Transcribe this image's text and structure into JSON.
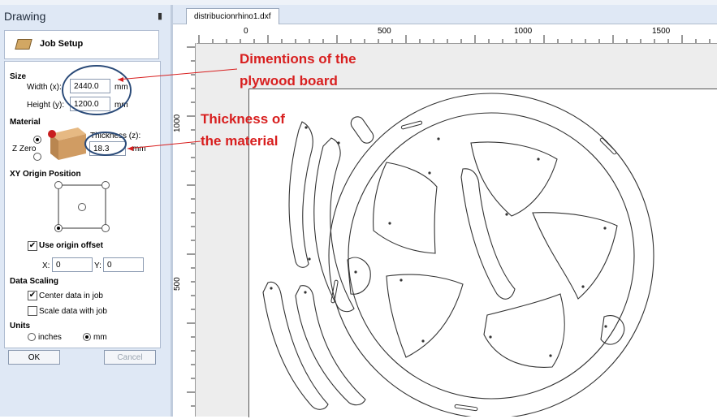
{
  "panel": {
    "title": "Drawing",
    "pin_glyph": "Ͱ",
    "job_setup_label": "Job Setup"
  },
  "size": {
    "header": "Size",
    "width_label": "Width (x):",
    "width_value": "2440.0",
    "width_unit": "mm",
    "height_label": "Height (y):",
    "height_value": "1200.0",
    "height_unit": "mm"
  },
  "material": {
    "header": "Material",
    "z_zero_label": "Z Zero",
    "thickness_label": "Thickness (z):",
    "thickness_value": "18.3",
    "thickness_unit": "mm"
  },
  "origin": {
    "header": "XY Origin Position",
    "use_offset_label": "Use origin offset",
    "x_label": "X:",
    "x_value": "0",
    "y_label": "Y:",
    "y_value": "0"
  },
  "scaling": {
    "header": "Data Scaling",
    "center_label": "Center data in job",
    "scale_label": "Scale data with job"
  },
  "units": {
    "header": "Units",
    "inches_label": "inches",
    "mm_label": "mm"
  },
  "buttons": {
    "ok": "OK",
    "cancel": "Cancel"
  },
  "tab": {
    "label": "distribucionrhino1.dxf"
  },
  "ruler": {
    "h_labels": [
      "0",
      "500",
      "1000",
      "1500"
    ],
    "v_labels": [
      "1000",
      "500"
    ]
  },
  "annotations": {
    "dimensions_line1": "Dimentions of the",
    "dimensions_line2": "plywood board",
    "thickness_line1": "Thickness of",
    "thickness_line2": "the material"
  },
  "colors": {
    "annotation": "#d81f1f",
    "circle_marker": "#2a4a78",
    "panel_bg": "#dfe8f5"
  }
}
